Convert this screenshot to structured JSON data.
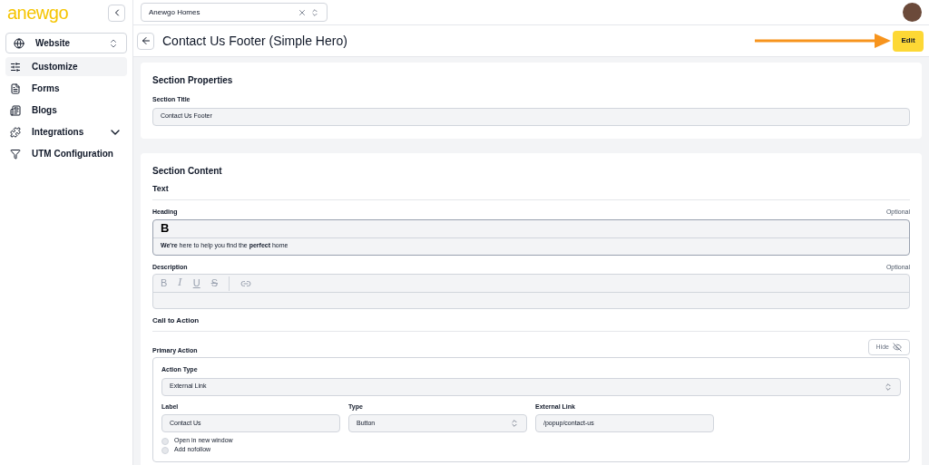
{
  "logo": "anewgo",
  "account_select": {
    "value": "Anewgo Homes"
  },
  "sidebar": {
    "site_select": "Website",
    "items": [
      {
        "label": "Customize",
        "kind": "link",
        "selected": true
      },
      {
        "label": "Forms",
        "kind": "link",
        "selected": false
      },
      {
        "label": "Blogs",
        "kind": "link",
        "selected": false
      },
      {
        "label": "Integrations",
        "kind": "group",
        "selected": false
      },
      {
        "label": "UTM Configuration",
        "kind": "link",
        "selected": false
      }
    ]
  },
  "page": {
    "title": "Contact Us Footer (Simple Hero)",
    "edit_button": "Edit"
  },
  "section_properties": {
    "title": "Section Properties",
    "field_label": "Section Title",
    "field_value": "Contact Us Footer"
  },
  "section_content": {
    "title": "Section Content",
    "text_group": "Text",
    "heading": {
      "label": "Heading",
      "optional": "Optional",
      "toolbar": [
        {
          "label": "B",
          "kind": "bold",
          "disabled": false
        }
      ],
      "value": "**We're** here to help you find the **perfect** home"
    },
    "description": {
      "label": "Description",
      "optional": "Optional",
      "toolbar": [
        {
          "label": "B",
          "kind": "bold",
          "disabled": true
        },
        {
          "label": "I",
          "kind": "italic",
          "disabled": true
        },
        {
          "label": "U",
          "kind": "underline",
          "disabled": true
        },
        {
          "label": "S",
          "kind": "strike",
          "disabled": true
        }
      ]
    },
    "cta_group": "Call to Action",
    "primary_action": {
      "title": "Primary Action",
      "hide_button": "Hide",
      "action_type_label": "Action Type",
      "action_type": "External Link",
      "label_label": "Label",
      "label_value": "Contact Us",
      "type_label": "Type",
      "type_value": "Button",
      "link_label": "External Link",
      "link_value": "/popup/contact-us",
      "options": [
        {
          "label": "Open in new window",
          "checked": false
        },
        {
          "label": "Add nofollow",
          "checked": false
        }
      ]
    }
  }
}
